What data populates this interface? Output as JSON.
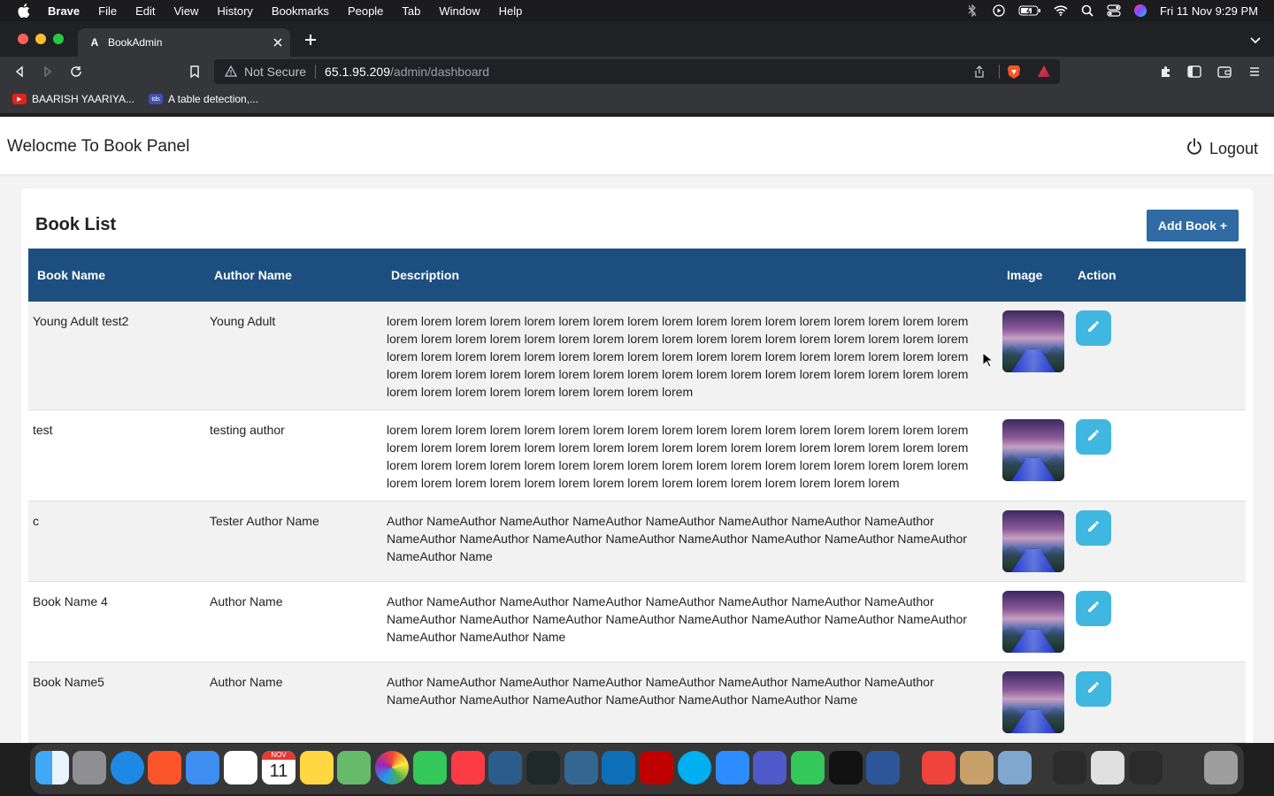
{
  "menubar": {
    "app": "Brave",
    "items": [
      "File",
      "Edit",
      "View",
      "History",
      "Bookmarks",
      "People",
      "Tab",
      "Window",
      "Help"
    ],
    "datetime": "Fri 11 Nov  9:29 PM"
  },
  "browser": {
    "tab_title": "BookAdmin",
    "tab_favicon": "A",
    "not_secure": "Not Secure",
    "url_host": "65.1.95.209",
    "url_path": "/admin/dashboard",
    "bookmarks": [
      {
        "label": "BAARISH YAARIYA...",
        "icon_color": "#e62117",
        "icon_text": "▶"
      },
      {
        "label": "A table detection,...",
        "icon_color": "#3f51b5",
        "icon_text": "tds"
      }
    ]
  },
  "header": {
    "title": "Welocme To Book Panel",
    "logout": "Logout"
  },
  "books": {
    "title": "Book List",
    "add_button": "Add Book +",
    "columns": [
      "Book Name",
      "Author Name",
      "Description",
      "Image",
      "Action"
    ],
    "rows": [
      {
        "name": "Young Adult test2",
        "author": "Young Adult",
        "description": "lorem lorem lorem lorem lorem lorem lorem lorem lorem lorem lorem lorem lorem lorem lorem lorem lorem lorem lorem lorem lorem lorem lorem lorem lorem lorem lorem lorem lorem lorem lorem lorem lorem lorem lorem lorem lorem lorem lorem lorem lorem lorem lorem lorem lorem lorem lorem lorem lorem lorem lorem lorem lorem lorem lorem lorem lorem lorem lorem lorem lorem lorem lorem lorem lorem lorem lorem lorem lorem lorem lorem lorem lorem lorem lorem lorem lorem"
      },
      {
        "name": "test",
        "author": "testing author",
        "description": "lorem lorem lorem lorem lorem lorem lorem lorem lorem lorem lorem lorem lorem lorem lorem lorem lorem lorem lorem lorem lorem lorem lorem lorem lorem lorem lorem lorem lorem lorem lorem lorem lorem lorem lorem lorem lorem lorem lorem lorem lorem lorem lorem lorem lorem lorem lorem lorem lorem lorem lorem lorem lorem lorem lorem lorem lorem lorem lorem lorem lorem lorem lorem lorem lorem lorem"
      },
      {
        "name": "c",
        "author": "Tester Author Name",
        "description": "Author NameAuthor NameAuthor NameAuthor NameAuthor NameAuthor NameAuthor NameAuthor NameAuthor NameAuthor NameAuthor NameAuthor NameAuthor NameAuthor NameAuthor NameAuthor NameAuthor Name"
      },
      {
        "name": "Book Name 4",
        "author": "Author Name",
        "description": "Author NameAuthor NameAuthor NameAuthor NameAuthor NameAuthor NameAuthor NameAuthor NameAuthor NameAuthor NameAuthor NameAuthor NameAuthor NameAuthor NameAuthor NameAuthor NameAuthor NameAuthor Name"
      },
      {
        "name": "Book Name5",
        "author": "Author Name",
        "description": "Author NameAuthor NameAuthor NameAuthor NameAuthor NameAuthor NameAuthor NameAuthor NameAuthor NameAuthor NameAuthor NameAuthor NameAuthor NameAuthor Name"
      }
    ]
  },
  "colors": {
    "header_blue": "#1c4f80",
    "button_blue": "#2f6aa3",
    "edit_button": "#3fb7e0"
  },
  "dock": {
    "icons": [
      "finder-icon",
      "launchpad-icon",
      "safari-icon",
      "brave-icon",
      "mail-icon",
      "reminders-icon",
      "calendar-icon",
      "notes-icon",
      "maps-icon",
      "photos-icon",
      "facetime-icon",
      "music-icon",
      "mysql-workbench-icon",
      "mongodb-compass-icon",
      "pgadmin-icon",
      "vscode-icon",
      "filezilla-icon",
      "skype-icon",
      "zoom-icon",
      "teams-icon",
      "numbers-icon",
      "terminal-icon",
      "word-icon",
      "anydesk-icon",
      "archive-utility-icon",
      "preview-icon",
      "window-thumbnail-icon",
      "window-thumbnail-icon",
      "window-thumbnail-icon",
      "trash-icon"
    ],
    "calendar_month": "NOV",
    "calendar_day": "11"
  }
}
